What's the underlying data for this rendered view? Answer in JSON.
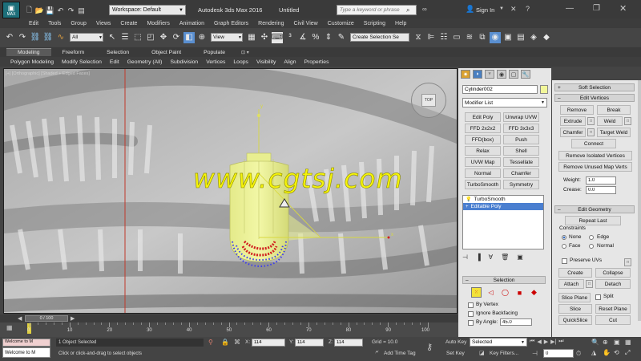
{
  "app": {
    "logo_text": "MAX",
    "workspace": "Workspace: Default",
    "title": "Autodesk 3ds Max 2016",
    "doc": "Untitled",
    "search_placeholder": "Type a keyword or phrase",
    "signin": "Sign In"
  },
  "menus": [
    "Edit",
    "Tools",
    "Group",
    "Views",
    "Create",
    "Modifiers",
    "Animation",
    "Graph Editors",
    "Rendering",
    "Civil View",
    "Customize",
    "Scripting",
    "Help"
  ],
  "toolbar": {
    "filter": "All",
    "view": "View",
    "selection_set": "Create Selection Se"
  },
  "ribbon_tabs": [
    "Modeling",
    "Freeform",
    "Selection",
    "Object Paint",
    "Populate"
  ],
  "ribbon_items": [
    "Polygon Modeling",
    "Modify Selection",
    "Edit",
    "Geometry (All)",
    "Subdivision",
    "Vertices",
    "Loops",
    "Visibility",
    "Align",
    "Properties"
  ],
  "viewport": {
    "label": "[+] [Orthographic] [Shaded + Edged Faces]",
    "viewcube": "TOP",
    "watermark": "www.cgtsj.com"
  },
  "modifier_panel": {
    "object_name": "Cylinder002",
    "color": "#f2f79a",
    "list_label": "Modifier List",
    "buttons": [
      "Edit Poly",
      "Unwrap UVW",
      "FFD 2x2x2",
      "FFD 3x3x3",
      "FFD(box)",
      "Push",
      "Relax",
      "Shell",
      "UVW Map",
      "Tessellate",
      "Normal",
      "Chamfer",
      "TurboSmooth",
      "Symmetry"
    ],
    "stack": [
      "TurboSmooth",
      "Editable Poly"
    ]
  },
  "selection_rollout": {
    "title": "Selection",
    "by_vertex": "By Vertex",
    "ignore_backfacing": "Ignore Backfacing",
    "by_angle": "By Angle:",
    "angle": "45.0"
  },
  "right_panel": {
    "soft_selection": "Soft Selection",
    "edit_vertices": "Edit Vertices",
    "remove": "Remove",
    "break": "Break",
    "extrude": "Extrude",
    "weld": "Weld",
    "chamfer": "Chamfer",
    "target_weld": "Target Weld",
    "connect": "Connect",
    "remove_isolated": "Remove Isolated Vertices",
    "remove_unused": "Remove Unused Map Verts",
    "weight_label": "Weight:",
    "weight": "1.0",
    "crease_label": "Crease:",
    "crease": "0.0",
    "edit_geometry": "Edit Geometry",
    "repeat_last": "Repeat Last",
    "constraints": "Constraints",
    "none": "None",
    "edge": "Edge",
    "face": "Face",
    "normal": "Normal",
    "preserve_uvs": "Preserve UVs",
    "create": "Create",
    "collapse": "Collapse",
    "attach": "Attach",
    "detach": "Detach",
    "slice_plane": "Slice Plane",
    "split": "Split",
    "slice": "Slice",
    "reset_plane": "Reset Plane",
    "quickslice": "QuickSlice",
    "cut": "Cut"
  },
  "timeline": {
    "frame": "0 / 100",
    "ticks": [
      "0",
      "10",
      "20",
      "30",
      "40",
      "50",
      "60",
      "70",
      "80",
      "90",
      "100"
    ]
  },
  "status": {
    "script": "Welcome to M",
    "selected": "1 Object Selected",
    "prompt": "Click or click-and-drag to select objects",
    "x_label": "X:",
    "x": "114",
    "y_label": "Y:",
    "y": "114",
    "z_label": "Z:",
    "z": "114",
    "grid": "Grid = 10.0",
    "add_time_tag": "Add Time Tag",
    "auto_key": "Auto Key",
    "set_key": "Set Key",
    "selected_dd": "Selected",
    "key_filters": "Key Filters...",
    "frame_value": "0"
  }
}
